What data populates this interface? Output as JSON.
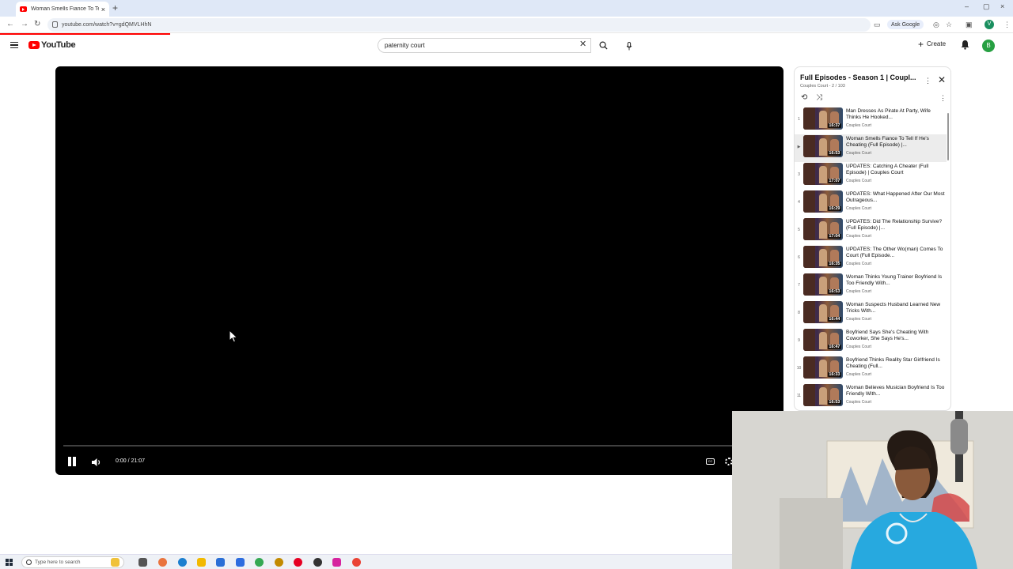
{
  "browser": {
    "tab_title": "Woman Smells Fiance To Tell If",
    "url": "youtube.com/watch?v=gdQMVLHhN",
    "ask_google": "Ask Google",
    "profile_initial": "V"
  },
  "youtube": {
    "logo_text": "YouTube",
    "search_value": "paternity court",
    "create_label": "Create",
    "avatar_initial": "B"
  },
  "player": {
    "time": "0:00 / 21:07",
    "progress_fraction": 0
  },
  "playlist": {
    "title": "Full Episodes - Season 1 | Coupl...",
    "subtitle": "Couples Court - 2 / 103",
    "items": [
      {
        "num": "1",
        "title": "Man Dresses As Pirate At Party, Wife Thinks He Hooked...",
        "channel": "Couples Court",
        "duration": "16:37",
        "active": false
      },
      {
        "num": "▶",
        "title": "Woman Smells Fiance To Tell If He's Cheating (Full Episode) |...",
        "channel": "Couples Court",
        "duration": "16:53",
        "active": true
      },
      {
        "num": "3",
        "title": "UPDATES: Catching A Cheater (Full Episode) | Couples Court",
        "channel": "Couples Court",
        "duration": "17:07",
        "active": false
      },
      {
        "num": "4",
        "title": "UPDATES: What Happened After Our Most Outrageous...",
        "channel": "Couples Court",
        "duration": "16:29",
        "active": false
      },
      {
        "num": "5",
        "title": "UPDATES: Did The Relationship Survive? (Full Episode) |...",
        "channel": "Couples Court",
        "duration": "17:04",
        "active": false
      },
      {
        "num": "6",
        "title": "UPDATES: The Other Wo(man) Comes To Court (Full Episode...",
        "channel": "Couples Court",
        "duration": "16:35",
        "active": false
      },
      {
        "num": "7",
        "title": "Woman Thinks Young Trainer Boyfriend Is Too Friendly With...",
        "channel": "Couples Court",
        "duration": "16:53",
        "active": false
      },
      {
        "num": "8",
        "title": "Woman Suspects Husband Learned New Tricks With...",
        "channel": "Couples Court",
        "duration": "16:44",
        "active": false
      },
      {
        "num": "9",
        "title": "Boyfriend Says She's Cheating With Coworker, She Says He's...",
        "channel": "Couples Court",
        "duration": "16:47",
        "active": false
      },
      {
        "num": "10",
        "title": "Boyfriend Thinks Reality Star Girlfriend Is Cheating (Full...",
        "channel": "Couples Court",
        "duration": "16:33",
        "active": false
      },
      {
        "num": "11",
        "title": "Woman Believes Musician Boyfriend Is Too Friendly With...",
        "channel": "Couples Court",
        "duration": "16:53",
        "active": false
      }
    ]
  },
  "taskbar": {
    "search_placeholder": "Type here to search"
  },
  "colors": {
    "brand_red": "#ff0000",
    "player_bg": "#000000",
    "active_row": "#ececec"
  }
}
